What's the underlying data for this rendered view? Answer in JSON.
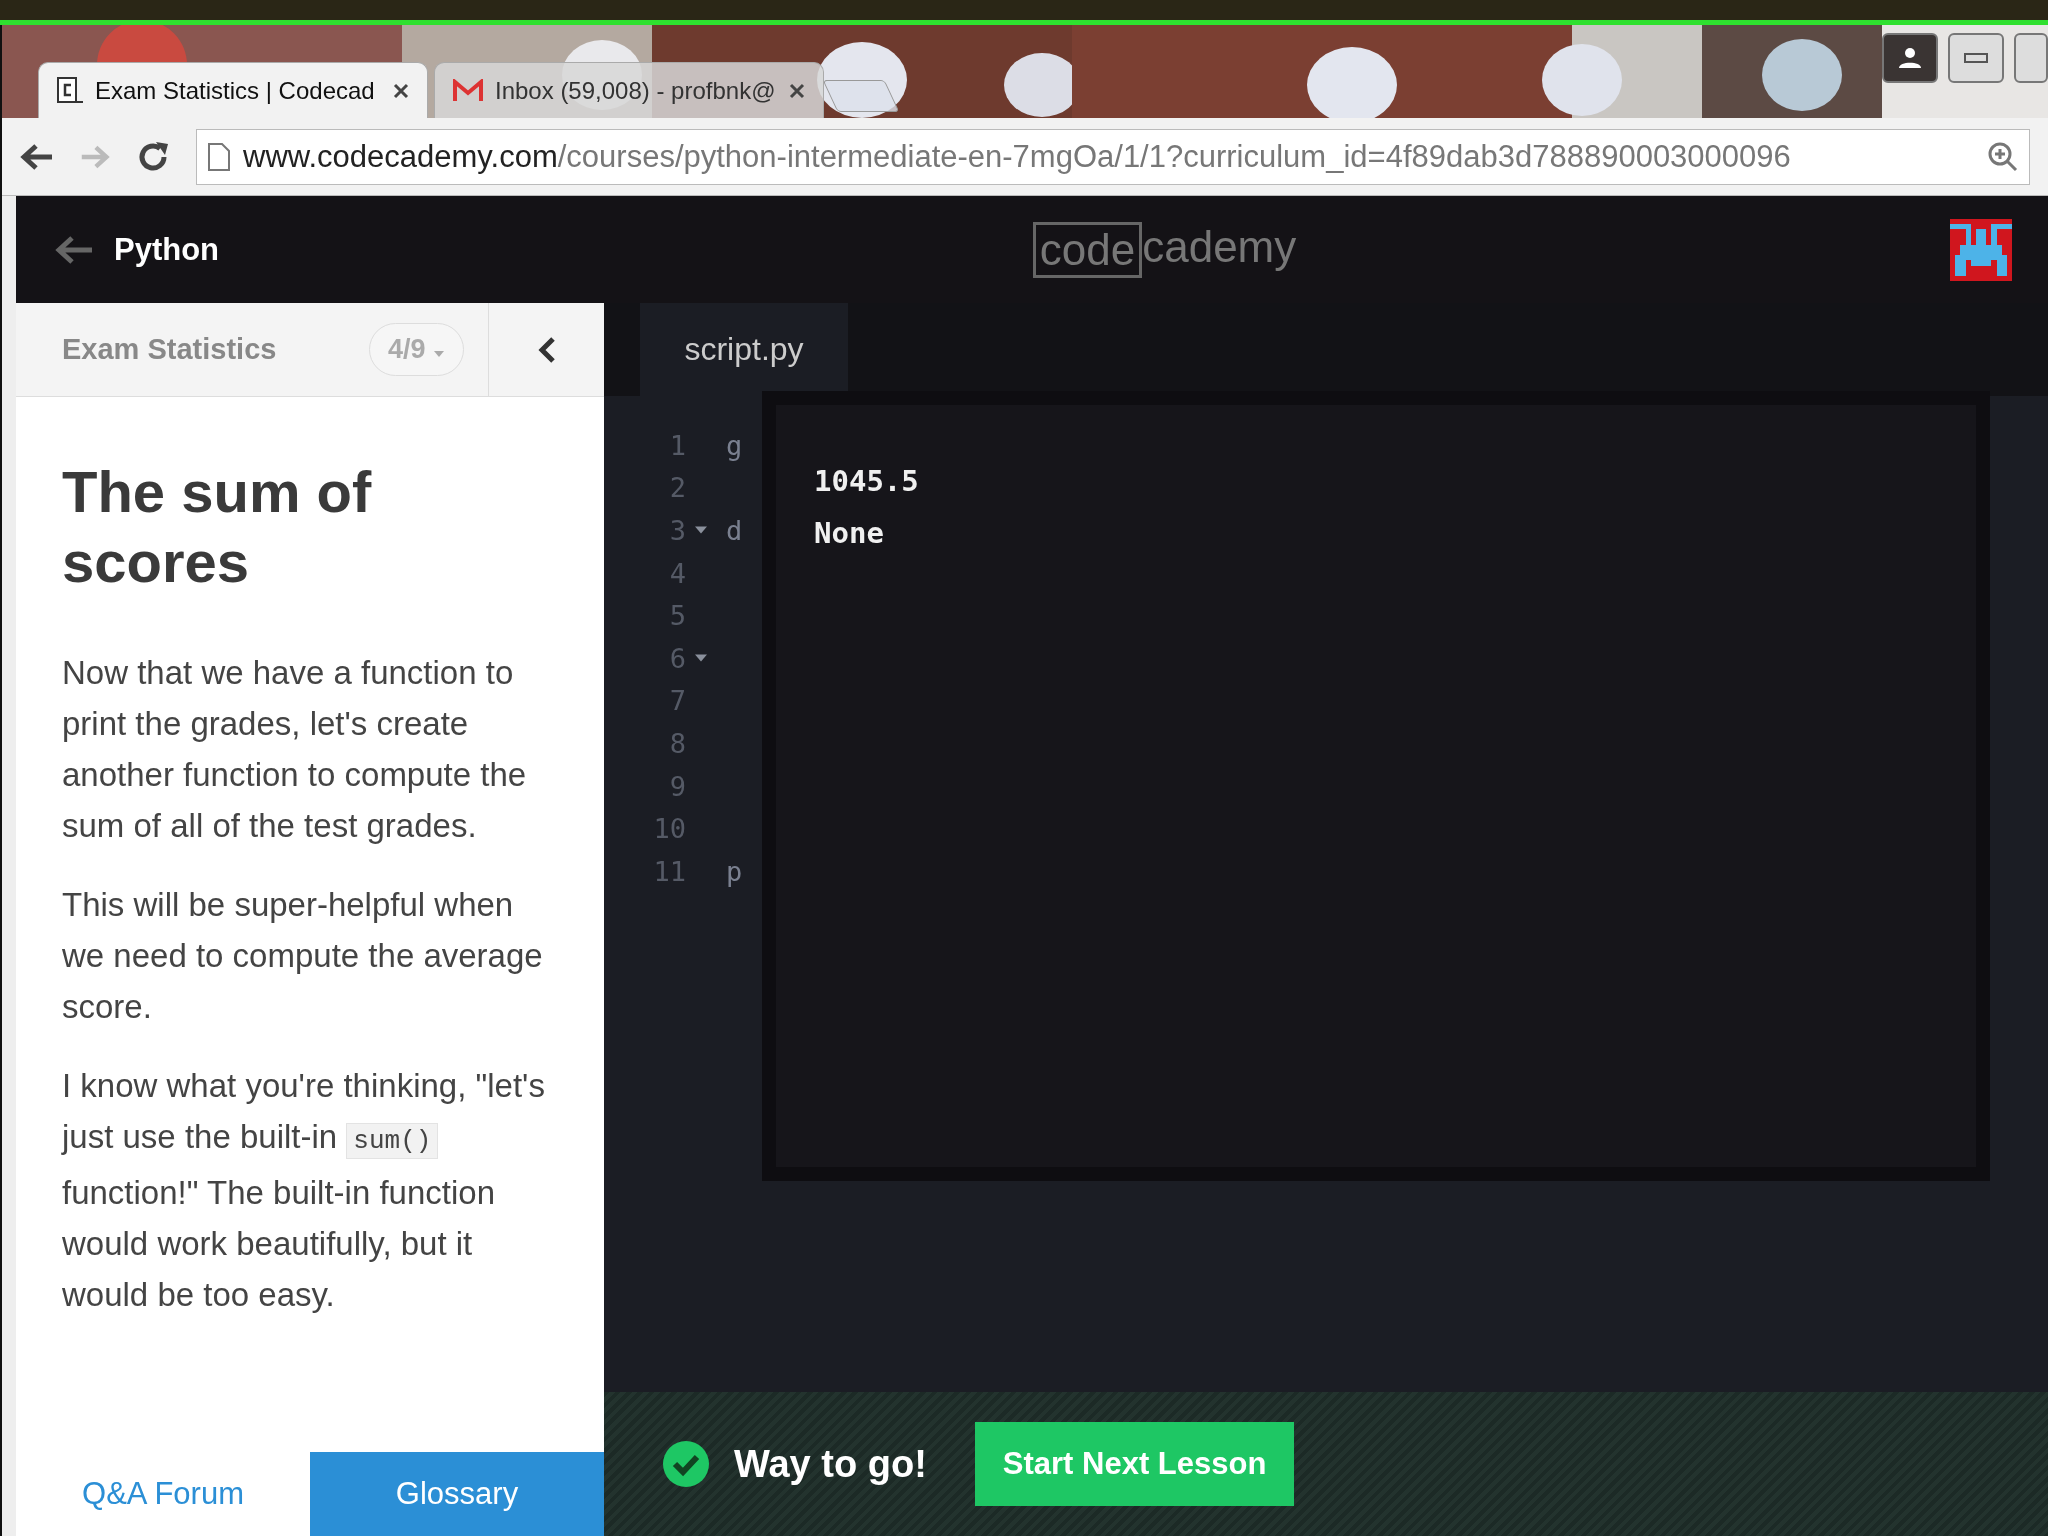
{
  "browser": {
    "tabs": [
      {
        "kind": "codecademy",
        "title": "Exam Statistics | Codecad",
        "selected": true
      },
      {
        "kind": "gmail",
        "title": "Inbox (59,008) - profbnk@",
        "selected": false
      }
    ],
    "forward_disabled": true,
    "url_host": "www.codecademy.com",
    "url_path": "/courses/python-intermediate-en-7mgOa/1/1?curriculum_id=4f89dab3d788890003000096"
  },
  "header": {
    "back_label": "Python",
    "logo": [
      "code",
      "cademy"
    ]
  },
  "lesson": {
    "unit": "Exam Statistics",
    "progress": "4/9",
    "title": "The sum of scores",
    "paragraphs": [
      [
        {
          "kind": "text",
          "text": "Now that we have a function to print the grades, let's create another function to compute the sum of all of the test grades."
        }
      ],
      [
        {
          "kind": "text",
          "text": "This will be super-helpful when we need to compute the average score."
        }
      ],
      [
        {
          "kind": "text",
          "text": "I know what you're thinking, \"let's just use the built-in "
        },
        {
          "kind": "code",
          "text": "sum()"
        },
        {
          "kind": "text",
          "text": " function!\" The built-in function would work beautifully, but it would be too easy."
        }
      ]
    ],
    "footer": [
      {
        "label": "Q&A Forum",
        "selected": false
      },
      {
        "label": "Glossary",
        "selected": true
      }
    ]
  },
  "editor": {
    "file_tab": "script.py",
    "lines": [
      {
        "number": "1",
        "text": "g",
        "foldable": false
      },
      {
        "number": "2",
        "foldable": false
      },
      {
        "number": "3",
        "text": "d",
        "foldable": true
      },
      {
        "number": "4",
        "foldable": false
      },
      {
        "number": "5",
        "foldable": false
      },
      {
        "number": "6",
        "foldable": true
      },
      {
        "number": "7",
        "foldable": false
      },
      {
        "number": "8",
        "foldable": false
      },
      {
        "number": "9",
        "foldable": false
      },
      {
        "number": "10",
        "foldable": false
      },
      {
        "number": "11",
        "text": "p",
        "foldable": false
      }
    ],
    "output": [
      "1045.5",
      "None"
    ]
  },
  "result": {
    "message": "Way to go!",
    "button": "Start Next Lesson"
  }
}
